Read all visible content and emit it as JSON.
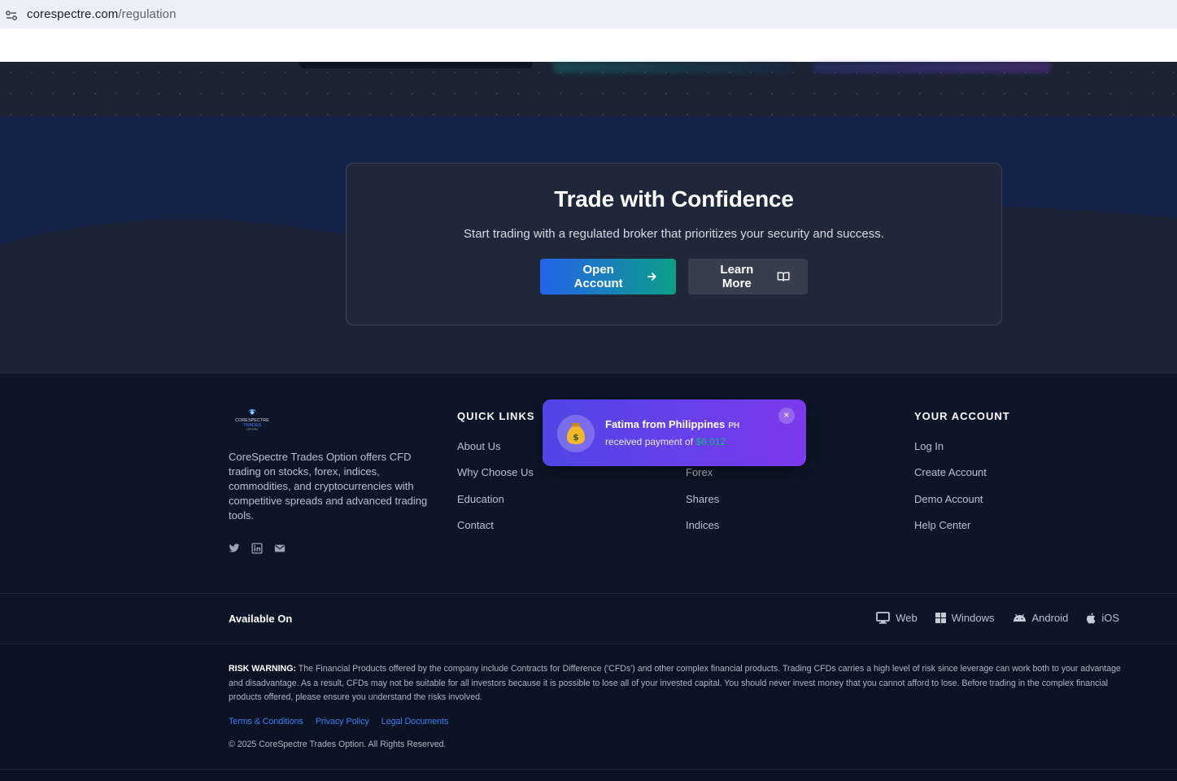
{
  "browser": {
    "url_domain": "corespectre.com",
    "url_path": "/regulation",
    "site_info_icon": "tune-icon"
  },
  "cta": {
    "title": "Trade with Confidence",
    "subtitle": "Start trading with a regulated broker that prioritizes your security and success.",
    "primary_label": "Open Account",
    "primary_icon": "arrow-right-icon",
    "secondary_label": "Learn More",
    "secondary_icon": "book-open-icon"
  },
  "footer": {
    "logo_text": "CORESPECTRE TRADES OPTION",
    "description": "CoreSpectre Trades Option offers CFD trading on stocks, forex, indices, commodities, and cryptocurrencies with competitive spreads and advanced trading tools.",
    "social": [
      "twitter-icon",
      "linkedin-icon",
      "mail-icon"
    ],
    "columns": [
      {
        "title": "QUICK LINKS",
        "links": [
          "About Us",
          "Why Choose Us",
          "Education",
          "Contact"
        ]
      },
      {
        "title": "",
        "links": [
          "",
          "Forex",
          "Shares",
          "Indices"
        ]
      },
      {
        "title": "YOUR ACCOUNT",
        "links": [
          "Log In",
          "Create Account",
          "Demo Account",
          "Help Center"
        ]
      }
    ],
    "available_label": "Available On",
    "platforms": [
      {
        "label": "Web",
        "icon": "monitor-icon"
      },
      {
        "label": "Windows",
        "icon": "windows-icon"
      },
      {
        "label": "Android",
        "icon": "android-icon"
      },
      {
        "label": "iOS",
        "icon": "apple-icon"
      }
    ],
    "risk_label": "RISK WARNING:",
    "risk_text": "The Financial Products offered by the company include Contracts for Difference ('CFDs') and other complex financial products. Trading CFDs carries a high level of risk since leverage can work both to your advantage and disadvantage. As a result, CFDs may not be suitable for all investors because it is possible to lose all of your invested capital. You should never invest money that you cannot afford to lose. Before trading in the complex financial products offered, please ensure you understand the risks involved.",
    "legal_links": [
      "Terms & Conditions",
      "Privacy Policy",
      "Legal Documents"
    ],
    "copyright": "© 2025 CoreSpectre Trades Option. All Rights Reserved."
  },
  "toast": {
    "name": "Fatima from Philippines",
    "flag": "PH",
    "message": "received payment of",
    "amount": "$6,012",
    "icon": "money-bag-icon",
    "close_label": "×"
  },
  "colors": {
    "accent_blue": "#2563eb",
    "accent_green": "#10b981",
    "toast_purple": "#7c3aed",
    "footer_bg": "#0d1628"
  }
}
